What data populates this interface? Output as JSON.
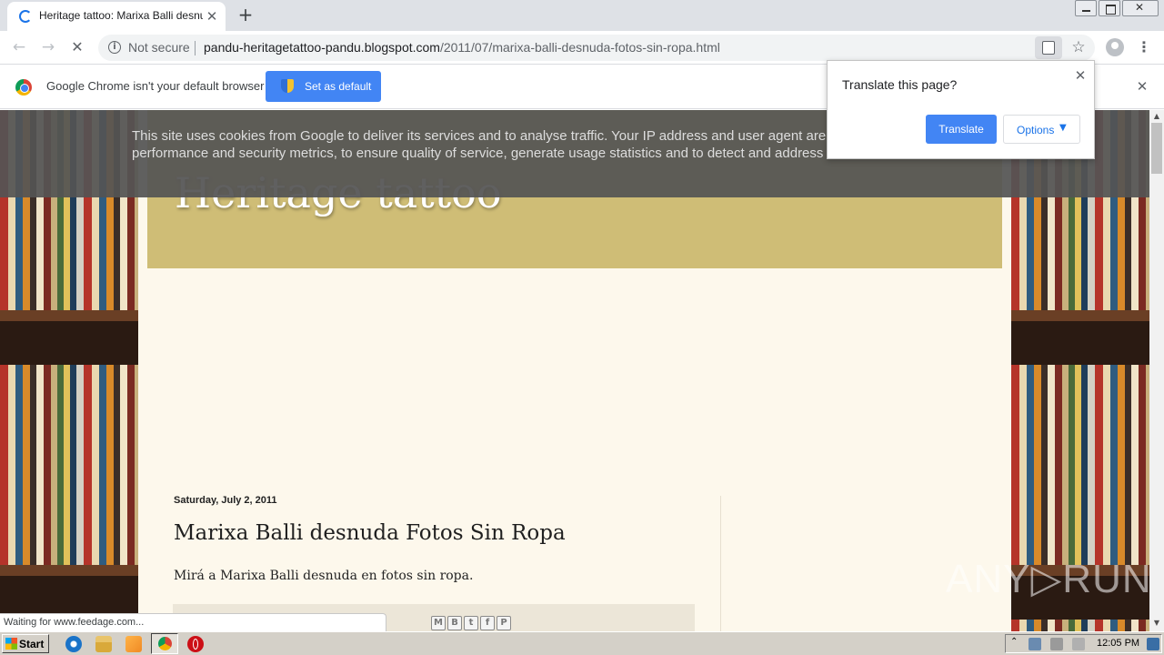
{
  "browser": {
    "tab": {
      "title": "Heritage tattoo: Marixa Balli desnuda Fotos Sin Ropa",
      "close_glyph": "✕"
    },
    "new_tab_glyph": "+",
    "nav": {
      "back_glyph": "←",
      "forward_glyph": "→",
      "stop_glyph": "✕"
    },
    "address_bar": {
      "security_label": "Not secure",
      "url_host": "pandu-heritagetattoo-pandu.blogspot.com",
      "url_path": "/2011/07/marixa-balli-desnuda-fotos-sin-ropa.html"
    },
    "star_glyph": "☆",
    "menu_glyph": "⋮"
  },
  "infobar": {
    "message": "Google Chrome isn't your default browser",
    "button_label": "Set as default",
    "close_glyph": "✕"
  },
  "translate_popup": {
    "prompt": "Translate this page?",
    "translate_label": "Translate",
    "options_label": "Options",
    "options_caret": "▼",
    "close_glyph": "✕"
  },
  "cookie_notice": {
    "text": "This site uses cookies from Google to deliver its services and to analyse traffic. Your IP address and user agent are shared with Google, together with performance and security metrics, to ensure quality of service, generate usage statistics and to detect and address abuse."
  },
  "blog": {
    "title": "Heritage tattoo",
    "post": {
      "date": "Saturday, July 2, 2011",
      "title": "Marixa Balli desnuda Fotos Sin Ropa",
      "body": "Mirá a Marixa Balli desnuda en fotos sin ropa."
    },
    "share_icons": [
      "email-icon",
      "blogger-icon",
      "twitter-icon",
      "facebook-icon",
      "pinterest-icon"
    ],
    "share_glyphs": {
      "email": "M",
      "blogger": "B",
      "twitter": "t",
      "facebook": "f",
      "pinterest": "P"
    }
  },
  "status_bar": {
    "text": "Waiting for www.feedage.com..."
  },
  "scrollbar": {
    "up_glyph": "▲",
    "down_glyph": "▼"
  },
  "watermark": {
    "text": "ANY▷RUN"
  },
  "taskbar": {
    "start_label": "Start",
    "tray_arrow": "⌃",
    "clock": "12:05 PM"
  }
}
